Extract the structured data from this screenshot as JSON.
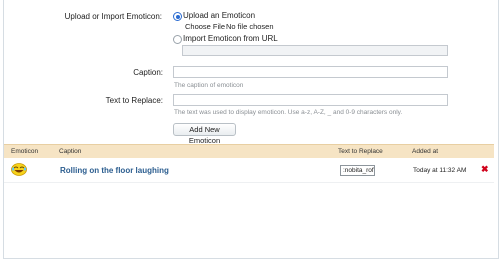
{
  "form": {
    "upload_label": "Upload or Import Emoticon:",
    "opt_upload": "Upload an Emoticon",
    "choose_file": "Choose File",
    "no_file": "No file chosen",
    "opt_import": "Import Emoticon from URL",
    "caption_label": "Caption:",
    "caption_placeholder": "The caption of emoticon",
    "replace_label": "Text to Replace:",
    "replace_hint": "The text was used to display emoticon. Use a-z, A-Z, _ and 0-9 characters only.",
    "add_button": "Add New Emoticon"
  },
  "table": {
    "headers": {
      "emoticon": "Emoticon",
      "caption": "Caption",
      "text": "Text to Replace",
      "added": "Added at"
    },
    "rows": [
      {
        "icon": "rofl-emoticon-icon",
        "caption": "Rolling on the floor laughing",
        "code": ":nobita_rofl:",
        "added": "Today at 11:32 AM"
      }
    ]
  },
  "colors": {
    "header_bg": "#f6e4c4",
    "link": "#2b5d8f",
    "delete": "#d0021b"
  }
}
